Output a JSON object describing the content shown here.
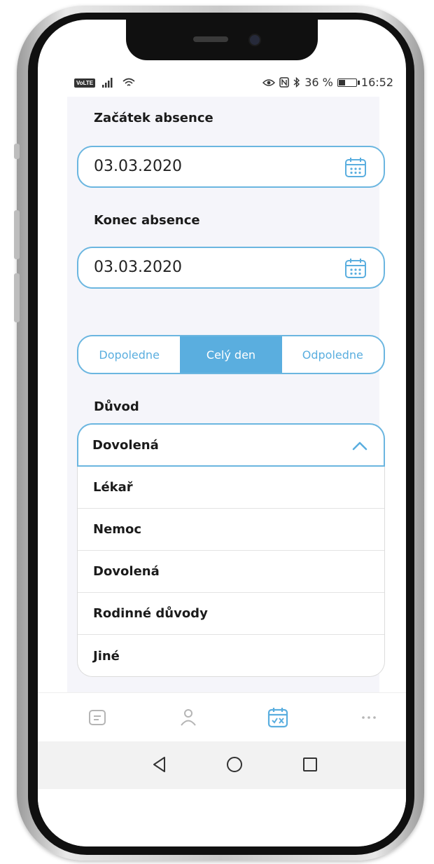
{
  "status_bar": {
    "network": "VoLTE",
    "battery_percent": "36 %",
    "battery_level": 0.36,
    "time": "16:52",
    "icons": [
      "signal-icon",
      "wifi-icon",
      "eye-icon",
      "nfc-icon",
      "bluetooth-icon",
      "battery-icon"
    ]
  },
  "form": {
    "start": {
      "label": "Začátek absence",
      "value": "03.03.2020",
      "icon": "calendar-icon"
    },
    "end": {
      "label": "Konec absence",
      "value": "03.03.2020",
      "icon": "calendar-icon"
    },
    "day_part": {
      "options": [
        "Dopoledne",
        "Celý den",
        "Odpoledne"
      ],
      "selected": "Celý den"
    },
    "reason": {
      "label": "Důvod",
      "selected": "Dovolená",
      "options": [
        "Lékař",
        "Nemoc",
        "Dovolená",
        "Rodinné důvody",
        "Jiné"
      ],
      "icon": "chevron-up-icon"
    }
  },
  "bottom_nav": {
    "items": [
      "list-icon",
      "profile-icon",
      "calendar-absence-icon",
      "more-icon"
    ],
    "active": "calendar-absence-icon"
  },
  "system_nav": [
    "back-icon",
    "home-icon",
    "recents-icon"
  ],
  "colors": {
    "accent": "#5aaedf",
    "border": "#6bb6e0",
    "text": "#1b1b1b",
    "background": "#f5f5fa",
    "nav_inactive": "#b5b5b5"
  }
}
